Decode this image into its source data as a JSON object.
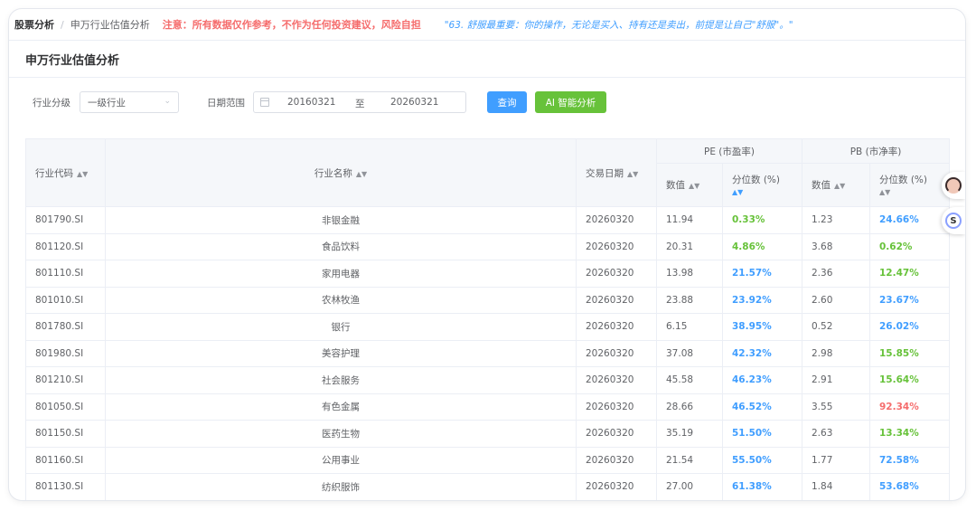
{
  "breadcrumb": {
    "root": "股票分析",
    "separator": "/",
    "current": "申万行业估值分析"
  },
  "notice": "注意：所有数据仅作参考，不作为任何投资建议，风险自担",
  "quote": "\"63. 舒服最重要：你的操作，无论是买入、持有还是卖出，前提是让自己\"舒服\"。\"",
  "page_title": "申万行业估值分析",
  "filters": {
    "level_label": "行业分级",
    "level_value": "一级行业",
    "date_label": "日期范围",
    "date_start": "20160321",
    "date_sep": "至",
    "date_end": "20260321",
    "query_button": "查询",
    "ai_button": "AI 智能分析"
  },
  "table": {
    "headers": {
      "code": "行业代码",
      "name": "行业名称",
      "date": "交易日期",
      "pe_group": "PE (市盈率)",
      "pb_group": "PB (市净率)",
      "value": "数值",
      "percentile": "分位数 (%)"
    },
    "rows": [
      {
        "code": "801790.SI",
        "name": "非银金融",
        "date": "20260320",
        "pe": "11.94",
        "pe_pct": "0.33%",
        "pe_color": "green",
        "pb": "1.23",
        "pb_pct": "24.66%",
        "pb_color": "blue"
      },
      {
        "code": "801120.SI",
        "name": "食品饮料",
        "date": "20260320",
        "pe": "20.31",
        "pe_pct": "4.86%",
        "pe_color": "green",
        "pb": "3.68",
        "pb_pct": "0.62%",
        "pb_color": "green"
      },
      {
        "code": "801110.SI",
        "name": "家用电器",
        "date": "20260320",
        "pe": "13.98",
        "pe_pct": "21.57%",
        "pe_color": "blue",
        "pb": "2.36",
        "pb_pct": "12.47%",
        "pb_color": "green"
      },
      {
        "code": "801010.SI",
        "name": "农林牧渔",
        "date": "20260320",
        "pe": "23.88",
        "pe_pct": "23.92%",
        "pe_color": "blue",
        "pb": "2.60",
        "pb_pct": "23.67%",
        "pb_color": "blue"
      },
      {
        "code": "801780.SI",
        "name": "银行",
        "date": "20260320",
        "pe": "6.15",
        "pe_pct": "38.95%",
        "pe_color": "blue",
        "pb": "0.52",
        "pb_pct": "26.02%",
        "pb_color": "blue"
      },
      {
        "code": "801980.SI",
        "name": "美容护理",
        "date": "20260320",
        "pe": "37.08",
        "pe_pct": "42.32%",
        "pe_color": "blue",
        "pb": "2.98",
        "pb_pct": "15.85%",
        "pb_color": "green"
      },
      {
        "code": "801210.SI",
        "name": "社会服务",
        "date": "20260320",
        "pe": "45.58",
        "pe_pct": "46.23%",
        "pe_color": "blue",
        "pb": "2.91",
        "pb_pct": "15.64%",
        "pb_color": "green"
      },
      {
        "code": "801050.SI",
        "name": "有色金属",
        "date": "20260320",
        "pe": "28.66",
        "pe_pct": "46.52%",
        "pe_color": "blue",
        "pb": "3.55",
        "pb_pct": "92.34%",
        "pb_color": "red"
      },
      {
        "code": "801150.SI",
        "name": "医药生物",
        "date": "20260320",
        "pe": "35.19",
        "pe_pct": "51.50%",
        "pe_color": "blue",
        "pb": "2.63",
        "pb_pct": "13.34%",
        "pb_color": "green"
      },
      {
        "code": "801160.SI",
        "name": "公用事业",
        "date": "20260320",
        "pe": "21.54",
        "pe_pct": "55.50%",
        "pe_color": "blue",
        "pb": "1.77",
        "pb_pct": "72.58%",
        "pb_color": "blue"
      },
      {
        "code": "801130.SI",
        "name": "纺织服饰",
        "date": "20260320",
        "pe": "27.00",
        "pe_pct": "61.38%",
        "pe_color": "blue",
        "pb": "1.84",
        "pb_pct": "53.68%",
        "pb_color": "blue"
      }
    ]
  },
  "icons": {
    "sort": "sort-icon",
    "calendar": "calendar-icon",
    "chevron": "chevron-down-icon",
    "avatar": "avatar-icon",
    "logo": "app-logo-icon"
  },
  "colors": {
    "accent": "#409eff",
    "success": "#67c23a",
    "danger": "#f56c6c"
  }
}
